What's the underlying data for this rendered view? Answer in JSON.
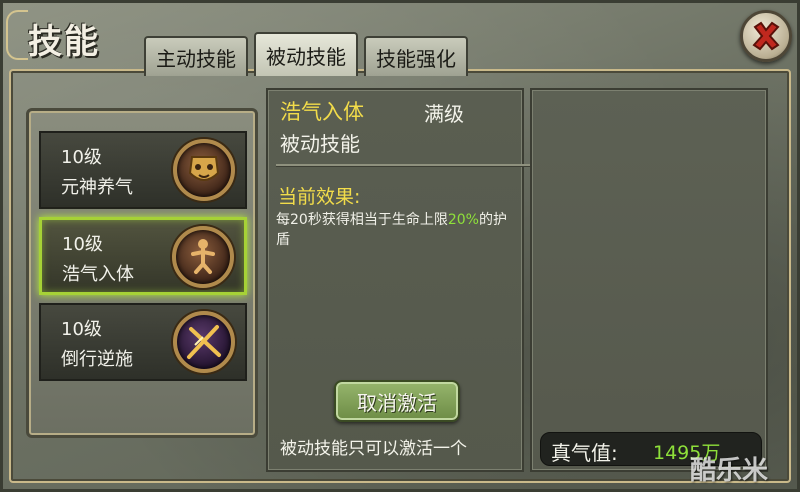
{
  "window": {
    "title": "技能",
    "close_icon": "close-x-icon",
    "close_color": "#c0281e"
  },
  "tabs": [
    {
      "label": "主动技能",
      "active": false
    },
    {
      "label": "被动技能",
      "active": true
    },
    {
      "label": "技能强化",
      "active": false
    }
  ],
  "skills": [
    {
      "level": "10级",
      "name": "元神养气",
      "icon": "mask-emblem-icon",
      "selected": false
    },
    {
      "level": "10级",
      "name": "浩气入体",
      "icon": "meditating-figure-icon",
      "selected": true
    },
    {
      "level": "10级",
      "name": "倒行逆施",
      "icon": "crossed-blades-icon",
      "selected": false
    }
  ],
  "detail": {
    "name": "浩气入体",
    "status": "满级",
    "type": "被动技能",
    "effect_title": "当前效果:",
    "effect_prefix": "每20秒获得相当于生命上限",
    "effect_highlight": "20%",
    "effect_suffix": "的护盾",
    "button_label": "取消激活",
    "hint": "被动技能只可以激活一个"
  },
  "qi": {
    "label": "真气值:",
    "value": "1495万"
  },
  "watermark": "酷乐米",
  "colors": {
    "accent_yellow": "#f2dc4a",
    "accent_green": "#8ee03a",
    "selection_glow": "#a6d236"
  }
}
